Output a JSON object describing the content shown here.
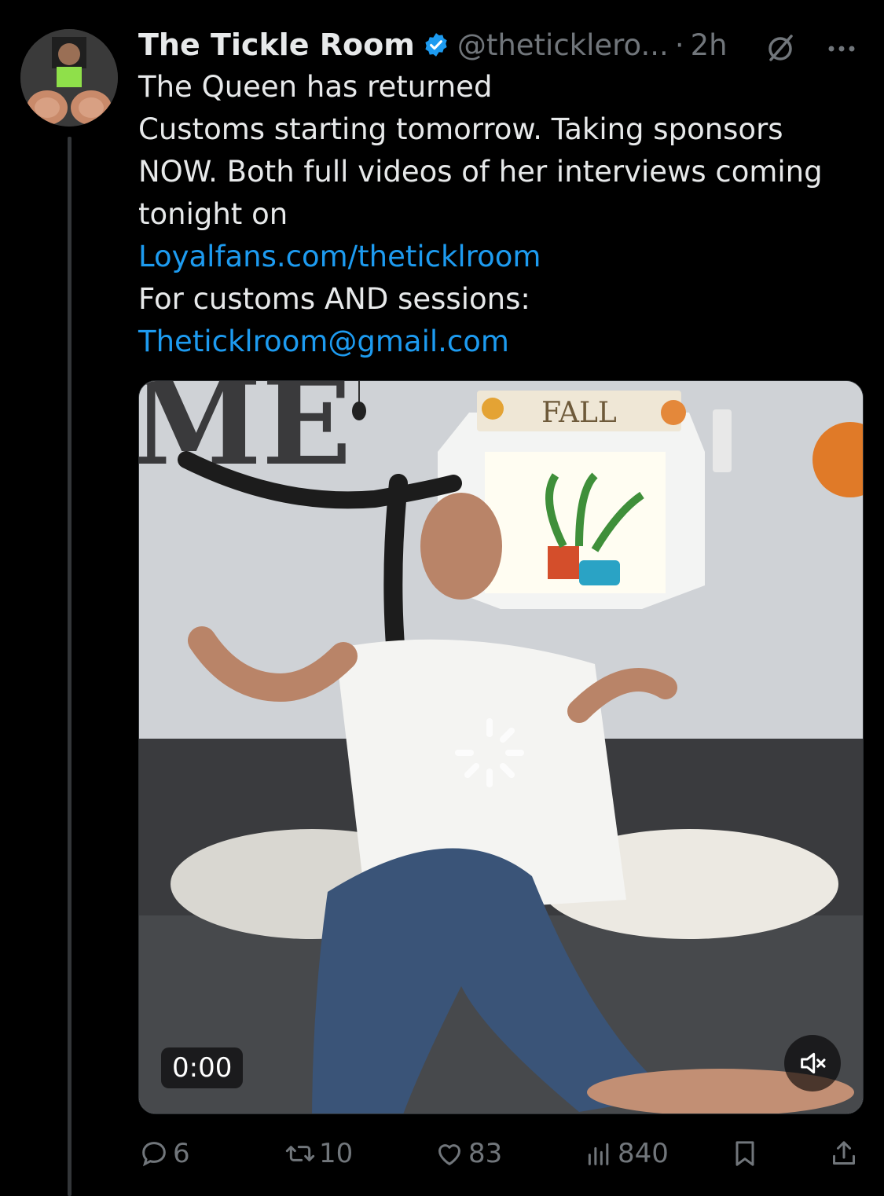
{
  "tweet": {
    "display_name": "The Tickle Room",
    "handle": "@theticklero...",
    "separator": "·",
    "time": "2h",
    "body_lines": [
      "The Queen has returned",
      "Customs starting tomorrow. Taking sponsors",
      "NOW. Both full videos of her interviews coming",
      "tonight on"
    ],
    "link_url": "Loyalfans.com/theticklroom",
    "customs_line": "For customs AND sessions:",
    "email": "Theticklroom@gmail.com"
  },
  "media": {
    "video_time": "0:00",
    "scene_wall_letters": "ME",
    "scene_sign_text": "FALL"
  },
  "actions": {
    "replies": "6",
    "reposts": "10",
    "likes": "83",
    "views": "840"
  },
  "colors": {
    "background": "#000000",
    "text": "#e7e9ea",
    "muted": "#71767b",
    "link": "#1d9bf0",
    "verified": "#1d9bf0"
  },
  "icons": [
    "verified-badge-icon",
    "grok-icon",
    "more-icon",
    "mute-icon",
    "reply-icon",
    "repost-icon",
    "like-icon",
    "views-icon",
    "bookmark-icon",
    "share-icon"
  ]
}
